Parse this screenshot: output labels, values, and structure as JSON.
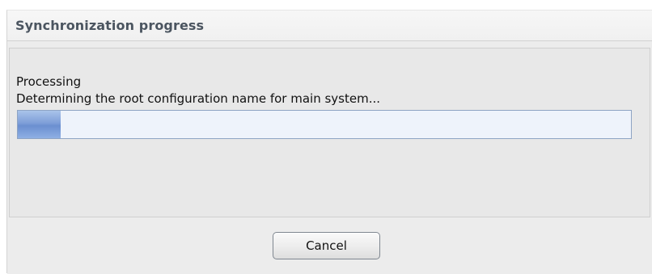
{
  "dialog": {
    "title": "Synchronization progress"
  },
  "status": {
    "label": "Processing",
    "message": "Determining the root configuration name for main system..."
  },
  "progress": {
    "value": 0.07
  },
  "buttons": {
    "cancel_label": "Cancel"
  }
}
